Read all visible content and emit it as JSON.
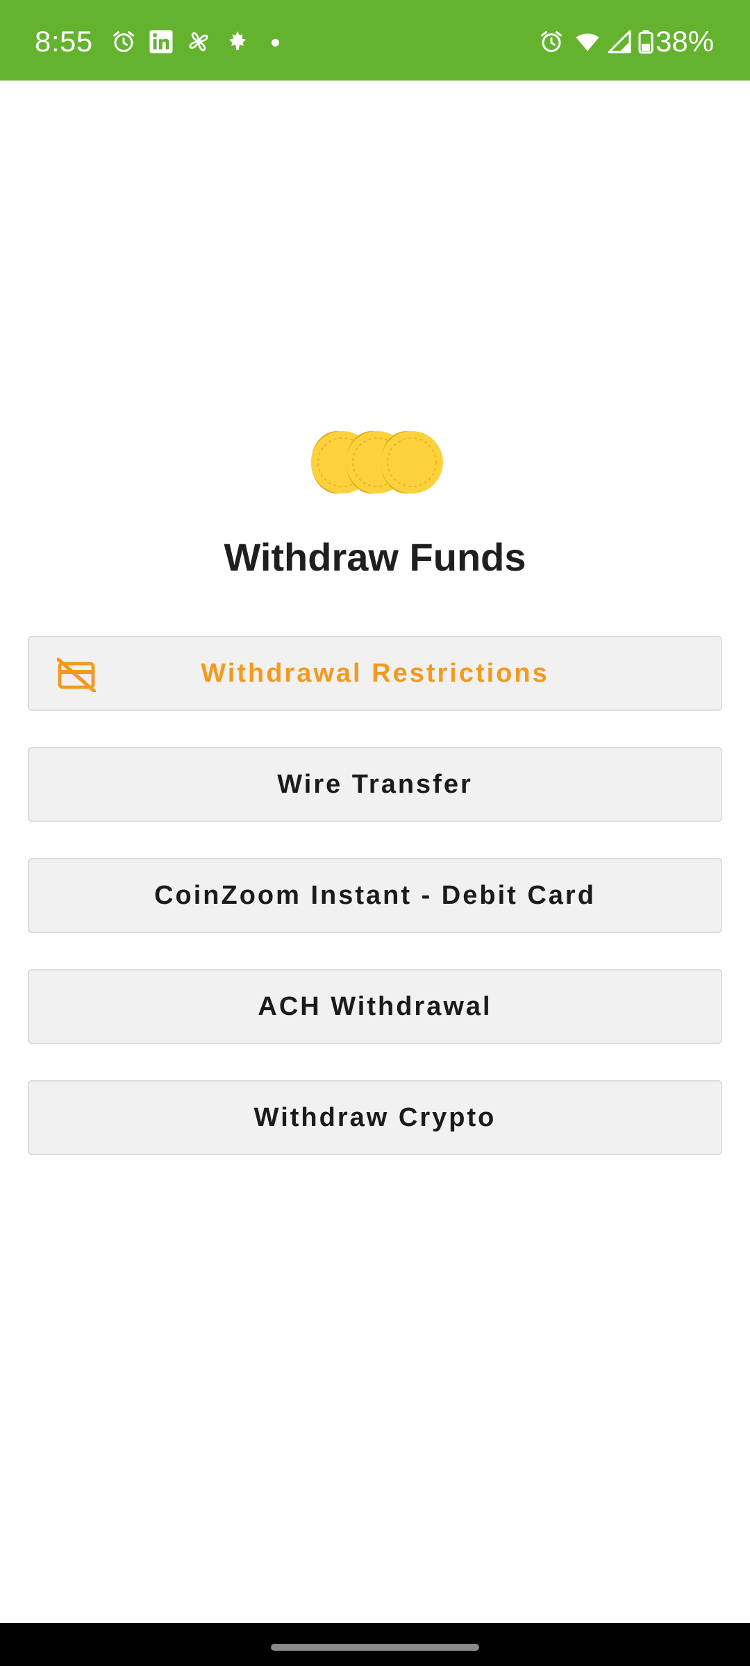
{
  "status_bar": {
    "time": "8:55",
    "battery": "38%",
    "background_color": "#64b32f",
    "left_icons": [
      "alarm-icon",
      "linkedin-icon",
      "pinwheel-icon",
      "maple-leaf-icon",
      "notification-dot-icon"
    ],
    "right_icons": [
      "alarm-icon",
      "wifi-icon",
      "signal-icon",
      "battery-icon"
    ]
  },
  "header": {
    "illustration": "coins-icon",
    "title": "Withdraw Funds"
  },
  "menu": {
    "restrictions": {
      "label": "Withdrawal Restrictions",
      "icon": "card-off-icon",
      "color": "#f39a1e"
    },
    "wire": {
      "label": "Wire Transfer"
    },
    "debit": {
      "label": "CoinZoom Instant - Debit Card"
    },
    "ach": {
      "label": "ACH Withdrawal"
    },
    "crypto": {
      "label": "Withdraw Crypto"
    }
  },
  "nav_bar": {
    "indicator": "home-indicator"
  }
}
